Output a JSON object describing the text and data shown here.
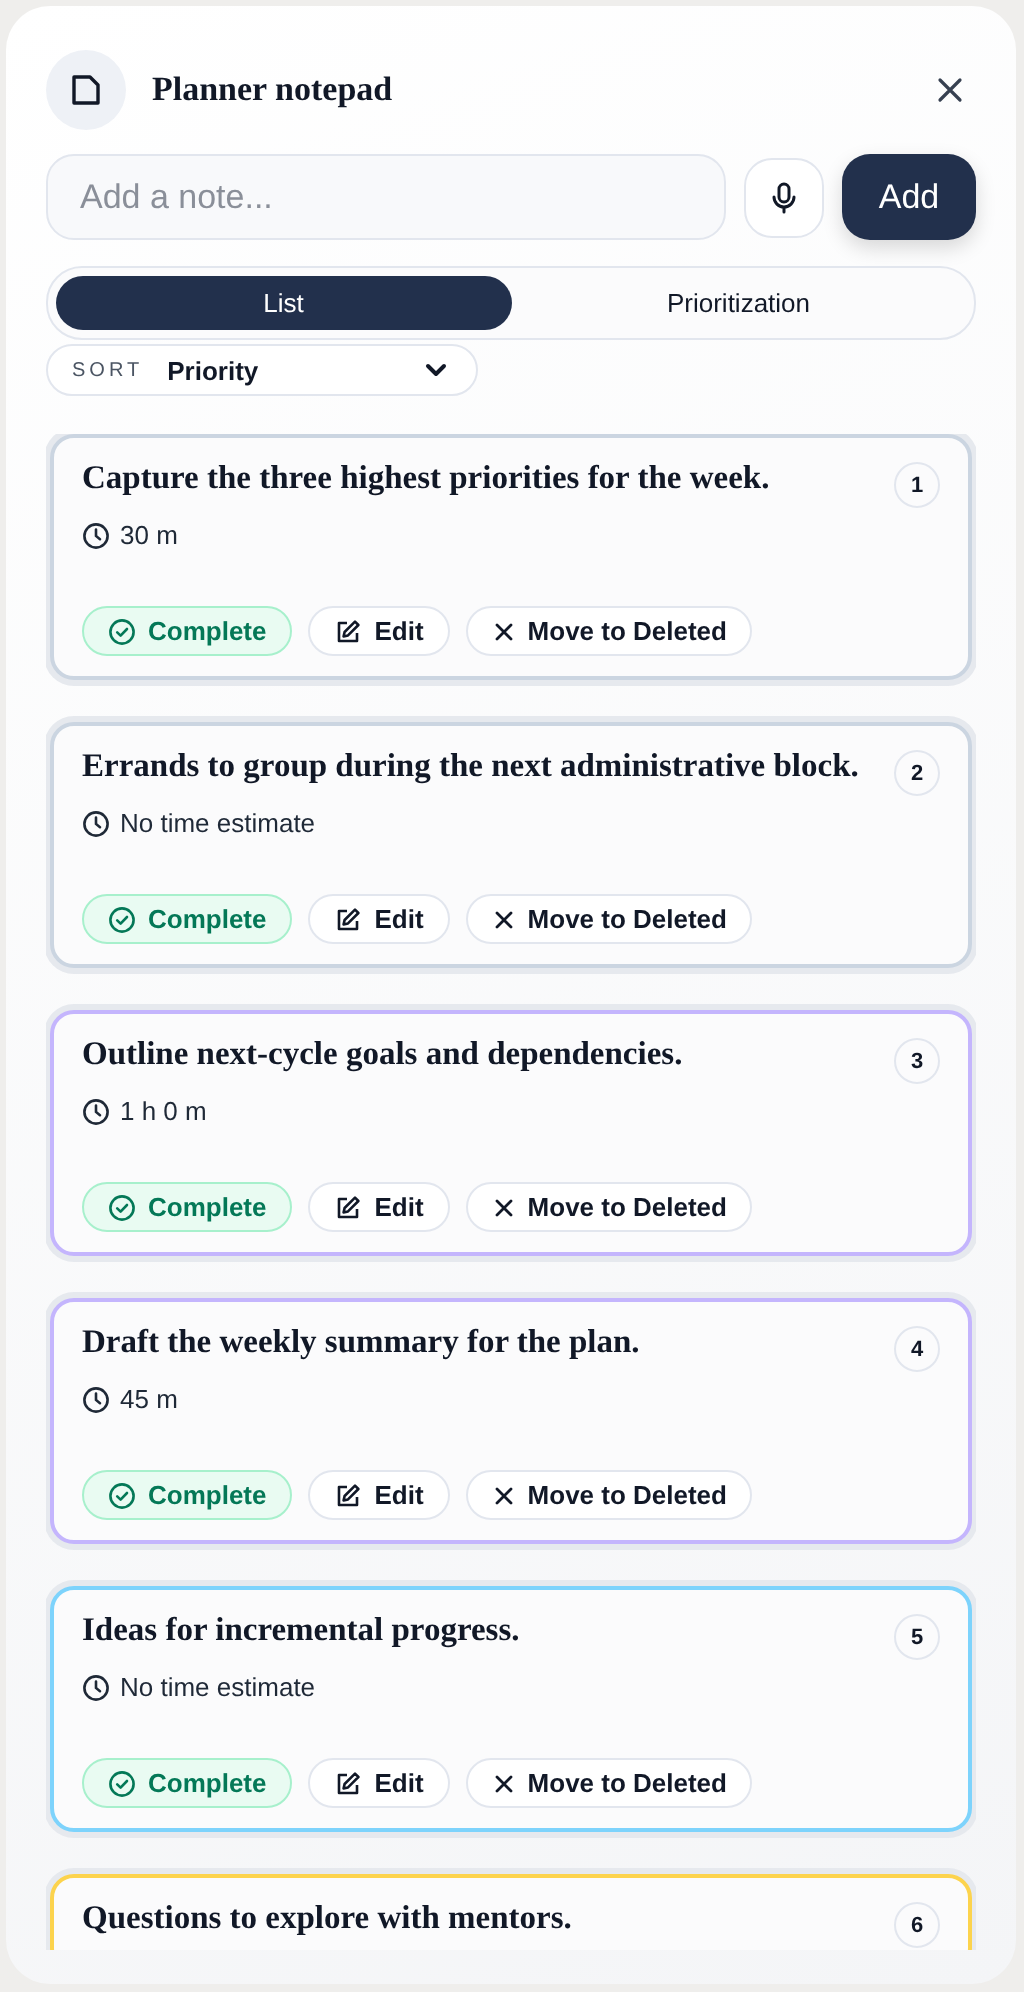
{
  "header": {
    "title": "Planner notepad"
  },
  "composer": {
    "placeholder": "Add a note...",
    "add_label": "Add"
  },
  "tabs": [
    {
      "label": "List",
      "selected": true
    },
    {
      "label": "Prioritization",
      "selected": false
    }
  ],
  "sort": {
    "label": "SORT",
    "value": "Priority"
  },
  "notes": [
    {
      "title": "Capture the three highest priorities for the week.",
      "estimate": "30 m",
      "rank": "1",
      "color": "#cbd5e1",
      "actions": [
        "Complete",
        "Edit",
        "Move to Deleted"
      ]
    },
    {
      "title": "Errands to group during the next administrative block.",
      "estimate": "No time estimate",
      "rank": "2",
      "color": "#cbd5e1",
      "actions": [
        "Complete",
        "Edit",
        "Move to Deleted"
      ]
    },
    {
      "title": "Outline next-cycle goals and dependencies.",
      "estimate": "1 h 0 m",
      "rank": "3",
      "color": "#c4b5fd",
      "actions": [
        "Complete",
        "Edit",
        "Move to Deleted"
      ]
    },
    {
      "title": "Draft the weekly summary for the plan.",
      "estimate": "45 m",
      "rank": "4",
      "color": "#c4b5fd",
      "actions": [
        "Complete",
        "Edit",
        "Move to Deleted"
      ]
    },
    {
      "title": "Ideas for incremental progress.",
      "estimate": "No time estimate",
      "rank": "5",
      "color": "#7dd3fc",
      "actions": [
        "Complete",
        "Edit",
        "Move to Deleted"
      ]
    },
    {
      "title": "Questions to explore with mentors.",
      "rank": "6",
      "color": "#fcd34d"
    }
  ]
}
